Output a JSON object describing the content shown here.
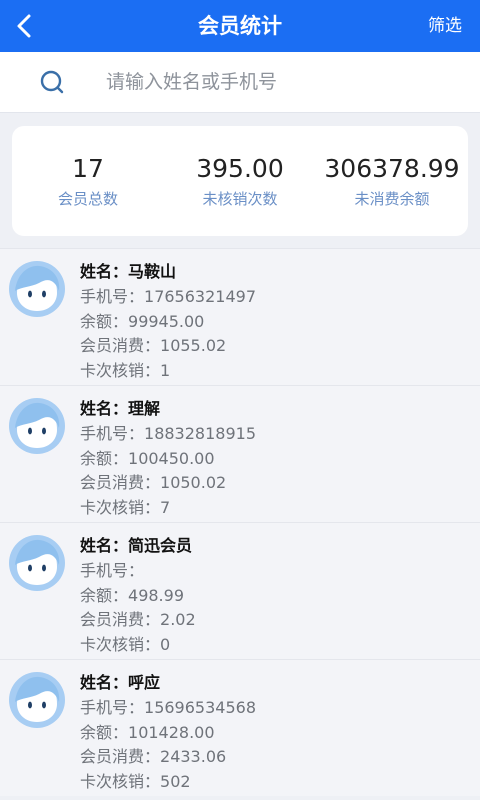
{
  "header": {
    "title": "会员统计",
    "filter_label": "筛选"
  },
  "search": {
    "placeholder": "请输入姓名或手机号"
  },
  "stats": [
    {
      "value": "17",
      "label": "会员总数"
    },
    {
      "value": "395.00",
      "label": "未核销次数"
    },
    {
      "value": "306378.99",
      "label": "未消费余额"
    }
  ],
  "labels": {
    "name": "姓名：",
    "phone": "手机号：",
    "balance": "余额：",
    "spend": "会员消费：",
    "card": "卡次核销："
  },
  "members": [
    {
      "name": "马鞍山",
      "phone": "17656321497",
      "balance": "99945.00",
      "spend": "1055.02",
      "card": "1"
    },
    {
      "name": "理解",
      "phone": "18832818915",
      "balance": "100450.00",
      "spend": "1050.02",
      "card": "7"
    },
    {
      "name": "简迅会员",
      "phone": "",
      "balance": "498.99",
      "spend": "2.02",
      "card": "0"
    },
    {
      "name": "呼应",
      "phone": "15696534568",
      "balance": "101428.00",
      "spend": "2433.06",
      "card": "502"
    }
  ],
  "colors": {
    "header": "#1b6ef3",
    "accent_label": "#6a8fc6",
    "avatar": "#a7cdf3"
  }
}
